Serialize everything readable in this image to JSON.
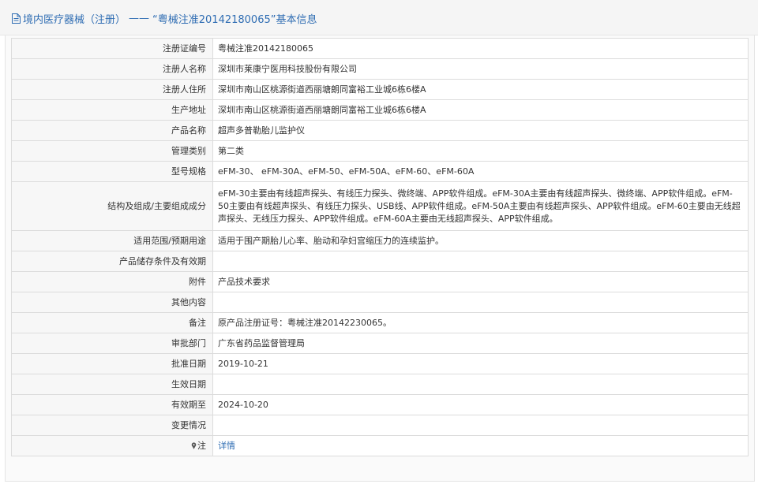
{
  "header": {
    "category": "境内医疗器械（注册）",
    "separator": "——",
    "title_quoted": "“粤械注准20142180065”基本信息"
  },
  "rows": [
    {
      "label": "注册证编号",
      "value": "粤械注准20142180065"
    },
    {
      "label": "注册人名称",
      "value": "深圳市莱康宁医用科技股份有限公司"
    },
    {
      "label": "注册人住所",
      "value": "深圳市南山区桃源街道西丽塘朗同富裕工业城6栋6楼A"
    },
    {
      "label": "生产地址",
      "value": "深圳市南山区桃源街道西丽塘朗同富裕工业城6栋6楼A"
    },
    {
      "label": "产品名称",
      "value": "超声多普勒胎儿监护仪"
    },
    {
      "label": "管理类别",
      "value": "第二类"
    },
    {
      "label": "型号规格",
      "value": "eFM-30、 eFM-30A、eFM-50、eFM-50A、eFM-60、eFM-60A"
    },
    {
      "label": "结构及组成/主要组成成分",
      "value": "eFM-30主要由有线超声探头、有线压力探头、微终端、APP软件组成。eFM-30A主要由有线超声探头、微终端、APP软件组成。eFM-50主要由有线超声探头、有线压力探头、USB线、APP软件组成。eFM-50A主要由有线超声探头、APP软件组成。eFM-60主要由无线超声探头、无线压力探头、APP软件组成。eFM-60A主要由无线超声探头、APP软件组成。"
    },
    {
      "label": "适用范围/预期用途",
      "value": "适用于围产期胎儿心率、胎动和孕妇宫缩压力的连续监护。"
    },
    {
      "label": "产品储存条件及有效期",
      "value": ""
    },
    {
      "label": "附件",
      "value": "产品技术要求"
    },
    {
      "label": "其他内容",
      "value": ""
    },
    {
      "label": "备注",
      "value": "原产品注册证号：粤械注准20142230065。"
    },
    {
      "label": "审批部门",
      "value": "广东省药品监督管理局"
    },
    {
      "label": "批准日期",
      "value": "2019-10-21"
    },
    {
      "label": "生效日期",
      "value": ""
    },
    {
      "label": "有效期至",
      "value": "2024-10-20"
    },
    {
      "label": "变更情况",
      "value": ""
    }
  ],
  "note": {
    "label": "注",
    "link_text": "详情",
    "icon": "pin-icon"
  },
  "colors": {
    "link": "#2f6db3",
    "header_bg": "#f5f5f5",
    "border": "#dcdcdc"
  }
}
